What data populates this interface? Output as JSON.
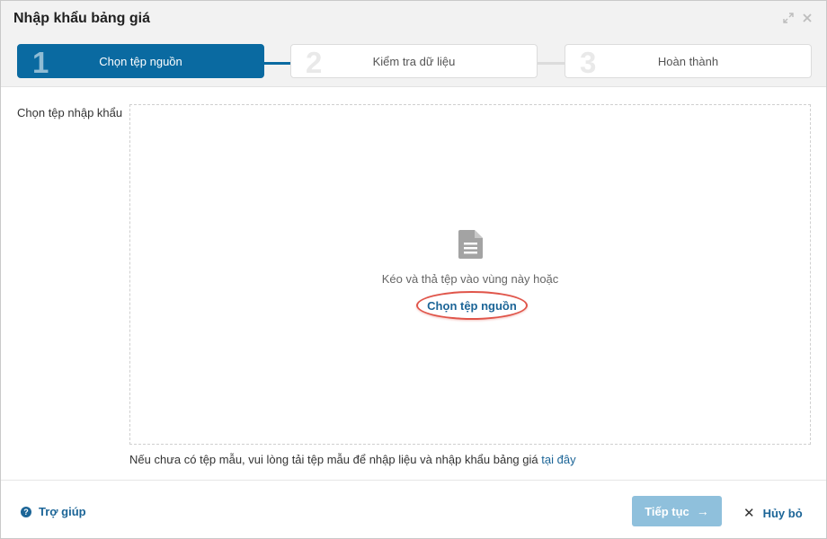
{
  "dialog": {
    "title": "Nhập khẩu bảng giá",
    "icons": {
      "expand": "expand-icon",
      "close": "close-icon"
    }
  },
  "steps": [
    {
      "number": "1",
      "label": "Chọn tệp nguồn",
      "active": true
    },
    {
      "number": "2",
      "label": "Kiểm tra dữ liệu",
      "active": false
    },
    {
      "number": "3",
      "label": "Hoàn thành",
      "active": false
    }
  ],
  "form": {
    "field_label": "Chọn tệp nhập khẩu",
    "dropzone": {
      "icon": "file-document-icon",
      "text": "Kéo và thả tệp vào vùng này hoặc",
      "choose_link": "Chọn tệp nguồn"
    },
    "note_text": "Nếu chưa có tệp mẫu, vui lòng tải tệp mẫu để nhập liệu và nhập khẩu bảng giá",
    "note_link": "tại đây"
  },
  "footer": {
    "help_label": "Trợ giúp",
    "next_label": "Tiếp tục",
    "cancel_label": "Hủy bỏ"
  },
  "colors": {
    "primary": "#0a6aa1",
    "link": "#1c6597",
    "next_button_disabled": "#8fc0dc",
    "highlight_ring": "#e0554a"
  }
}
